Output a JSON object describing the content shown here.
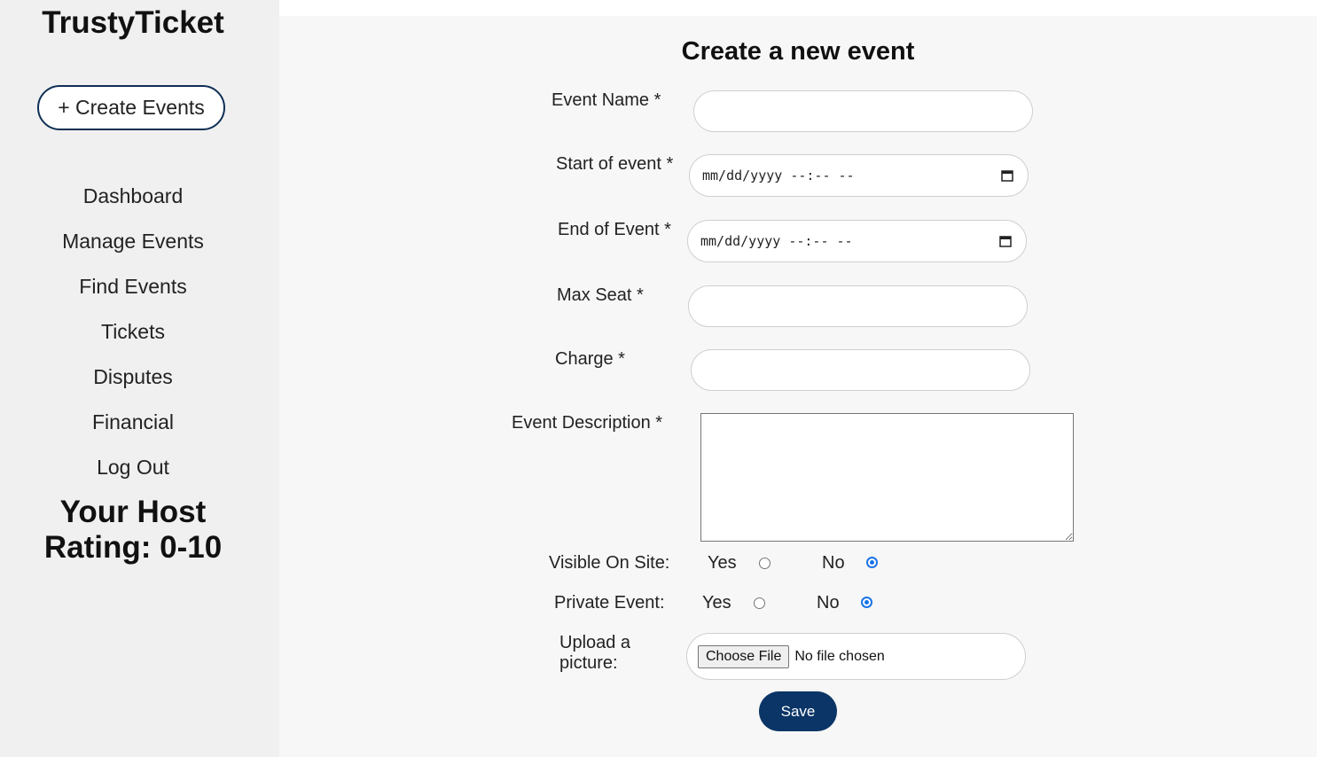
{
  "sidebar": {
    "brand": "TrustyTicket",
    "create_button": "+ Create Events",
    "nav": [
      "Dashboard",
      "Manage Events",
      "Find Events",
      "Tickets",
      "Disputes",
      "Financial",
      "Log Out"
    ],
    "rating_line1": "Your Host",
    "rating_line2": "Rating: 0-10"
  },
  "form": {
    "title": "Create a new event",
    "event_name_label": "Event Name *",
    "event_name_value": "",
    "start_label": "Start of event *",
    "start_value": "mm/dd/yyyy --:-- --",
    "end_label": "End of Event *",
    "end_value": "mm/dd/yyyy --:-- --",
    "max_seat_label": "Max Seat *",
    "max_seat_value": "",
    "charge_label": "Charge *",
    "charge_value": "",
    "description_label": "Event Description *",
    "description_value": "",
    "visible_label": "Visible On Site:",
    "private_label": "Private Event:",
    "yes": "Yes",
    "no": "No",
    "visible_selected": "No",
    "private_selected": "No",
    "upload_label_line1": "Upload a",
    "upload_label_line2": "picture:",
    "choose_file": "Choose File",
    "file_status": "No file chosen",
    "save": "Save"
  },
  "colors": {
    "accent": "#0b3566",
    "radio_checked": "#1a73e8",
    "sidebar_bg": "#f0f0f0",
    "main_bg": "#f7f7f7"
  }
}
